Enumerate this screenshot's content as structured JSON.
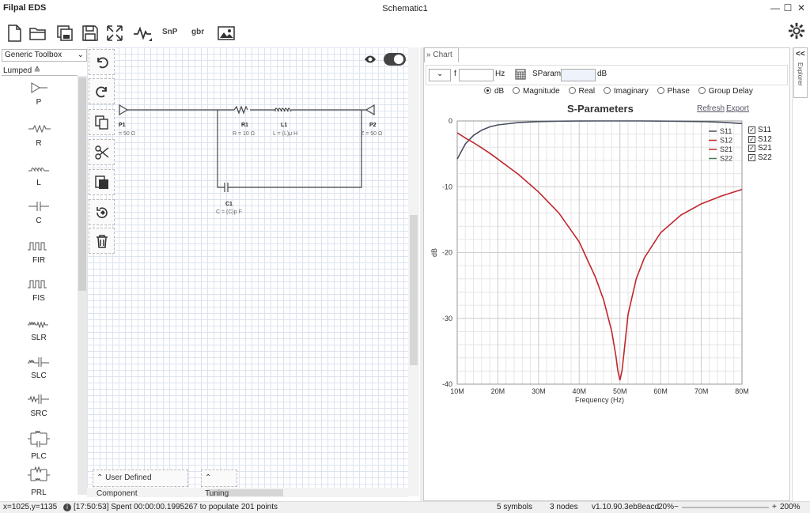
{
  "app": {
    "title": "Filpal EDS",
    "document": "Schematic1"
  },
  "window_controls": {
    "minimize": "—",
    "maximize": "☐",
    "close": "✕"
  },
  "toolbar": {
    "snp_label": "SnP",
    "gbr_label": "gbr",
    "icons": [
      "new-file-icon",
      "open-folder-icon",
      "save-all-icon",
      "save-icon",
      "fit-view-icon",
      "simulate-icon",
      "snp-export",
      "gbr-export",
      "image-export-icon"
    ]
  },
  "toolbox": {
    "selected": "Generic Toolbox",
    "category": "Lumped ≙"
  },
  "palette": [
    {
      "label": "P",
      "icon": "port-icon"
    },
    {
      "label": "R",
      "icon": "resistor-icon"
    },
    {
      "label": "L",
      "icon": "inductor-icon"
    },
    {
      "label": "C",
      "icon": "capacitor-icon"
    },
    {
      "label": "FIR",
      "icon": "fir-icon"
    },
    {
      "label": "FIS",
      "icon": "fis-icon"
    },
    {
      "label": "SLR",
      "icon": "slr-icon"
    },
    {
      "label": "SLC",
      "icon": "slc-icon"
    },
    {
      "label": "SRC",
      "icon": "src-icon"
    },
    {
      "label": "PLC",
      "icon": "plc-icon"
    },
    {
      "label": "PRL",
      "icon": "prl-icon"
    }
  ],
  "schematic": {
    "p1": {
      "name": "P1",
      "value": "= 50 Ω"
    },
    "r1": {
      "name": "R1",
      "value": "R = 10 Ω"
    },
    "l1": {
      "name": "L1",
      "value": "L = (L)μ H"
    },
    "p2": {
      "name": "P2",
      "value": "Z = 50 Ω"
    },
    "c1": {
      "name": "C1",
      "value": "C = (C)p F"
    }
  },
  "bottom_tabs": {
    "user_defined": "User Defined Component",
    "tuning": "Tuning"
  },
  "chart_panel": {
    "tab_label": "Chart",
    "f_label": "f",
    "f_value": "",
    "hz_label": "Hz",
    "sparams_label": "SParams",
    "sparams_value": "",
    "db_label": "dB",
    "modes": [
      {
        "label": "dB",
        "selected": true
      },
      {
        "label": "Magnitude",
        "selected": false
      },
      {
        "label": "Real",
        "selected": false
      },
      {
        "label": "Imaginary",
        "selected": false
      },
      {
        "label": "Phase",
        "selected": false
      },
      {
        "label": "Group Delay",
        "selected": false
      }
    ],
    "refresh": "Refresh",
    "export": "Export"
  },
  "explorer": {
    "label": "Explorer",
    "collapse": "<<"
  },
  "chart_data": {
    "type": "line",
    "title": "S-Parameters",
    "xlabel": "Frequency (Hz)",
    "ylabel": "dB",
    "xlim": [
      10,
      80
    ],
    "ylim": [
      -40,
      0
    ],
    "x_ticks": [
      "10M",
      "20M",
      "30M",
      "40M",
      "50M",
      "60M",
      "70M",
      "80M"
    ],
    "y_ticks": [
      "0",
      "-10",
      "-20",
      "-30",
      "-40"
    ],
    "grid": true,
    "legend_inside": [
      "S11",
      "S12",
      "S21",
      "S22"
    ],
    "legend_outside": [
      "S11",
      "S12",
      "S21",
      "S22"
    ],
    "series": [
      {
        "name": "S11",
        "color": "#4a5060",
        "x": [
          10,
          12,
          14,
          16,
          18,
          20,
          25,
          30,
          35,
          40,
          45,
          50,
          55,
          60,
          65,
          70,
          75,
          80
        ],
        "y": [
          -5.8,
          -3.5,
          -2.2,
          -1.4,
          -0.9,
          -0.6,
          -0.25,
          -0.1,
          -0.04,
          -0.01,
          0,
          0,
          0,
          -0.02,
          -0.05,
          -0.1,
          -0.2,
          -0.4
        ]
      },
      {
        "name": "S21",
        "color": "#c0262c",
        "x": [
          10,
          12,
          14,
          16,
          18,
          20,
          25,
          30,
          35,
          40,
          44,
          46,
          48,
          49,
          49.5,
          50,
          50.5,
          51,
          52,
          54,
          56,
          60,
          65,
          70,
          75,
          80
        ],
        "y": [
          -1.8,
          -2.6,
          -3.3,
          -4.1,
          -4.9,
          -5.8,
          -8.1,
          -10.8,
          -14.0,
          -18.4,
          -23.8,
          -27.2,
          -32.0,
          -35.7,
          -38.0,
          -39.4,
          -38.0,
          -35.2,
          -29.4,
          -24.0,
          -20.8,
          -17.0,
          -14.3,
          -12.6,
          -11.4,
          -10.4
        ]
      }
    ]
  },
  "status": {
    "coords": "x=1025,y=1135",
    "message": "[17:50:53] Spent 00:00:00.1995267 to populate 201 points",
    "symbols": "5 symbols",
    "nodes": "3 nodes",
    "version": "v1.10.90.3eb8eacd",
    "zoom_min": "20%",
    "zoom_minus": "−",
    "zoom_plus": "+",
    "zoom_max": "200%"
  }
}
